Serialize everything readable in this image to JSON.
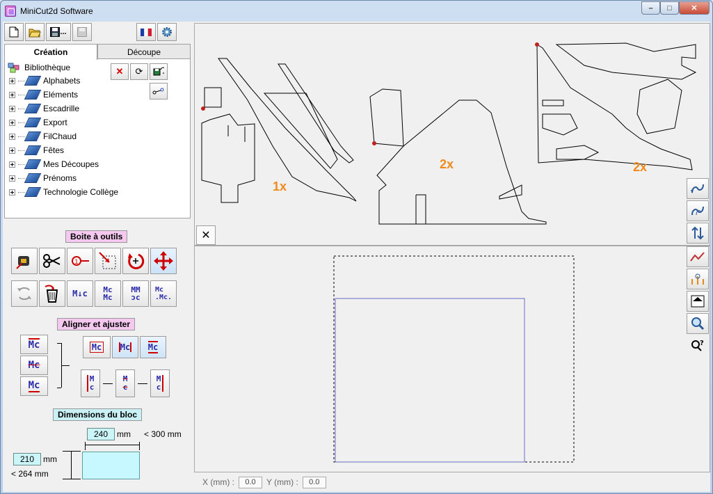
{
  "window": {
    "title": "MiniCut2d Software",
    "controls": [
      "–",
      "□",
      "✕"
    ]
  },
  "toolbar": {
    "save_label": "...",
    "flag": "fr"
  },
  "tabs": [
    {
      "label": "Création",
      "active": true
    },
    {
      "label": "Découpe",
      "active": false
    }
  ],
  "library": {
    "root": "Bibliothèque",
    "items": [
      "Alphabets",
      "Eléments",
      "Escadrille",
      "Export",
      "FilChaud",
      "Fêtes",
      "Mes Découpes",
      "Prénoms",
      "Technologie Collège"
    ]
  },
  "toolbox": {
    "label": "Boite à outils"
  },
  "align": {
    "label": "Aligner et ajuster"
  },
  "dimensions": {
    "label": "Dimensions du bloc",
    "width": "240",
    "width_unit": "mm",
    "width_limit": "< 300 mm",
    "height": "210",
    "height_unit": "mm",
    "height_limit": "< 264 mm"
  },
  "canvas": {
    "labels": [
      "1x",
      "2x",
      "2x"
    ],
    "label_color": "#f08a1a"
  },
  "status": {
    "x_label": "X (mm) :",
    "x_value": "0.0",
    "y_label": "Y (mm) :",
    "y_value": "0.0"
  }
}
